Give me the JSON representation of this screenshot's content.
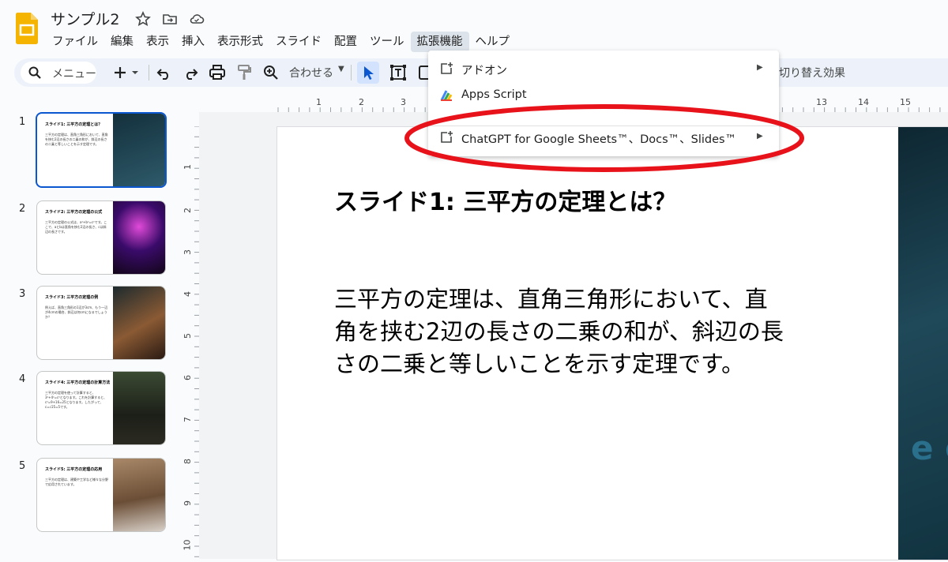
{
  "app": {
    "title": "サンプル2",
    "menu": [
      "ファイル",
      "編集",
      "表示",
      "挿入",
      "表示形式",
      "スライド",
      "配置",
      "ツール",
      "拡張機能",
      "ヘルプ"
    ],
    "active_menu_index": 8
  },
  "toolbar": {
    "search_label": "メニュー",
    "zoom_label": "合わせる",
    "transition_label": "切り替え効果"
  },
  "extensions_menu": {
    "items": [
      {
        "label": "アドオン",
        "icon": "addon-icon",
        "has_submenu": true
      },
      {
        "label": "Apps Script",
        "icon": "apps-script-icon",
        "has_submenu": false
      },
      {
        "label": "ChatGPT for Google Sheets™、Docs™、Slides™",
        "icon": "addon-icon",
        "has_submenu": true
      }
    ],
    "highlight_color": "#e8121b"
  },
  "filmstrip": {
    "slides": [
      {
        "number": "1",
        "title": "スライド1: 三平方の定理とは？",
        "body": "三平方の定理は、直角三角形において、直角を挟む2辺の長さの二乗の和が、斜辺の長さの二乗と等しいことを示す定理です。",
        "image_color": "#1e3f4b",
        "selected": true
      },
      {
        "number": "2",
        "title": "スライド2: 三平方の定理の公式",
        "body": "三平方の定理の公式は、a²+b²=c²です。ここで、aとbは直角を挟む2辺の長さ、cは斜辺の長さです。",
        "image_color": "#2a1038",
        "selected": false
      },
      {
        "number": "3",
        "title": "スライド3: 三平方の定理の例",
        "body": "例えば、直角三角形の1辺が3cm、もう一辺が4cmの場合、斜辺は何cmになるでしょうか？",
        "image_color": "#5a3a22",
        "selected": false
      },
      {
        "number": "4",
        "title": "スライド4: 三平方の定理の計算方法",
        "body": "三平方の定理を使って計算すると、3²+4²=c²となります。これを計算すると、c²=9+16=25となります。したがって、c=√25=5です。",
        "image_color": "#2f3a2a",
        "selected": false
      },
      {
        "number": "5",
        "title": "スライド5: 三平方の定理の応用",
        "body": "三平方の定理は、建築や工学など様々な分野で応用されています。",
        "image_color": "#8a6a4e",
        "selected": false
      }
    ]
  },
  "ruler": {
    "horizontal": [
      "1",
      "2",
      "3",
      "13",
      "14",
      "15"
    ],
    "vertical": [
      "1",
      "2",
      "3",
      "4",
      "5",
      "6",
      "7",
      "8",
      "9",
      "10"
    ]
  },
  "slide": {
    "title": "スライド1: 三平方の定理とは？",
    "body": "三平方の定理は、直角三角形において、直角を挟む2辺の長さの二乗の和が、斜辺の長さの二乗と等しいことを示す定理です。",
    "image_text": "e co"
  },
  "colors": {
    "accent": "#0b57d0",
    "logo": "#f4b400",
    "toolbar_bg": "#edf2fa"
  }
}
